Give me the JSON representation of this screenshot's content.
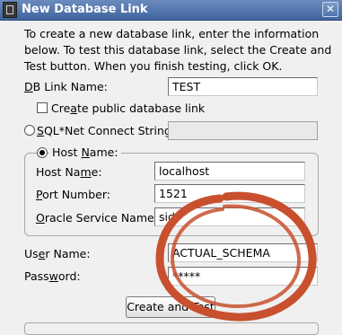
{
  "window": {
    "title": "New Database Link",
    "close_glyph": "✕"
  },
  "intro_text": "To create a new database link, enter the information below. To test this database link, select the Create and Test button. When you finish testing, click OK.",
  "db_link_name": {
    "label_u": "D",
    "label_rest": "B Link Name:",
    "value": "TEST"
  },
  "create_public": {
    "label_pre": "Cre",
    "label_u": "a",
    "label_rest": "te public database link",
    "checked": false
  },
  "sqlnet": {
    "label_u": "S",
    "label_rest": "QL*Net Connect String:",
    "value": "",
    "selected": false
  },
  "host_group": {
    "radio_label_pre": "Host ",
    "radio_label_u": "N",
    "radio_label_rest": "ame:",
    "selected": true,
    "host_name": {
      "label_pre": "Host Na",
      "label_u": "m",
      "label_rest": "e:",
      "value": "localhost"
    },
    "port": {
      "label_u": "P",
      "label_rest": "ort Number:",
      "value": "1521"
    },
    "sid": {
      "label_u": "O",
      "label_rest": "racle Service Name:",
      "value": "sid"
    }
  },
  "user_name": {
    "label_pre": "Us",
    "label_u": "e",
    "label_rest": "r Name:",
    "value": "ACTUAL_SCHEMA"
  },
  "password": {
    "label_pre": "Pass",
    "label_u": "w",
    "label_rest": "ord:",
    "value": "*****"
  },
  "create_test_button": {
    "label": "Create and Test"
  },
  "colors": {
    "titlebar": "#4a6fa8",
    "annotation_ring": "#c8502e"
  }
}
